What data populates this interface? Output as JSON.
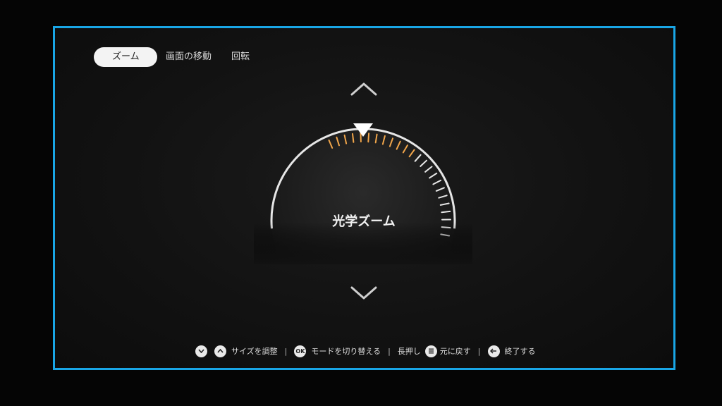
{
  "tabs": [
    {
      "label": "ズーム",
      "active": true
    },
    {
      "label": "画面の移動",
      "active": false
    },
    {
      "label": "回転",
      "active": false
    }
  ],
  "dial": {
    "label": "光学ズーム",
    "level_fraction": 0.5,
    "active_color": "#f2a64a",
    "inactive_color": "#e8e8e8"
  },
  "hints": {
    "size_adjust": "サイズを調整",
    "ok_key": "OK",
    "switch_mode": "モードを切り替える",
    "long_press": "長押し",
    "restore": "元に戻す",
    "exit": "終了する"
  },
  "icons": {
    "down": "chevron-down-icon",
    "up": "chevron-up-icon",
    "menu": "menu-icon",
    "back": "back-arrow-icon"
  },
  "colors": {
    "frame": "#19a6e6",
    "tab_active_bg": "#f3f3f3"
  }
}
